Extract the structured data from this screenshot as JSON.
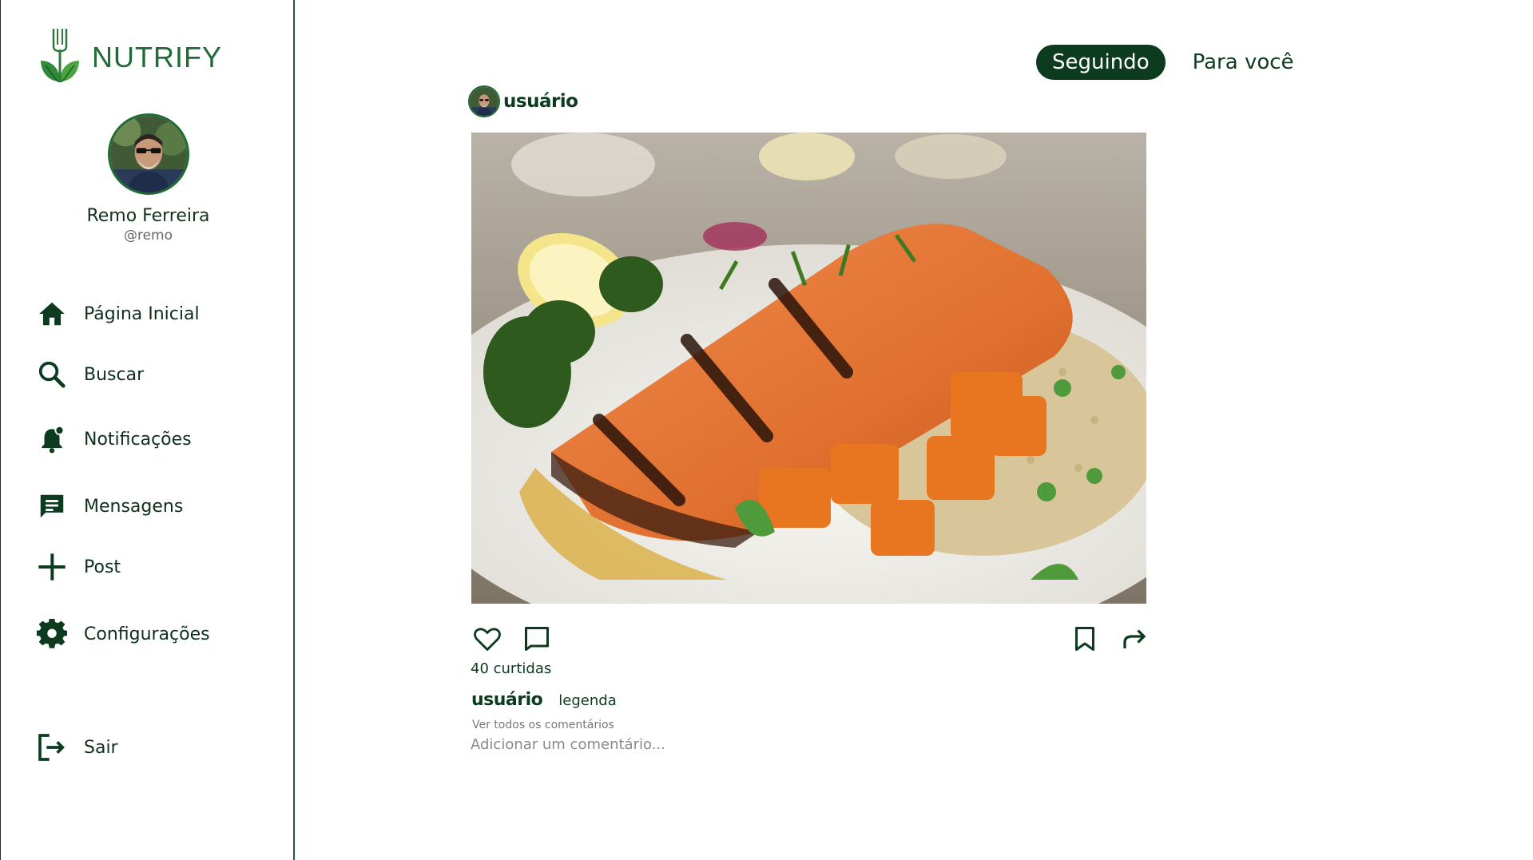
{
  "app": {
    "name": "NUTRIFY",
    "brand_color": "#1d6b35",
    "dark_color": "#0c3b1f"
  },
  "profile": {
    "name": "Remo Ferreira",
    "handle": "@remo"
  },
  "nav": {
    "home": {
      "label": "Página Inicial",
      "icon": "home-icon"
    },
    "search": {
      "label": "Buscar",
      "icon": "search-icon"
    },
    "notifications": {
      "label": "Notificações",
      "icon": "bell-icon"
    },
    "messages": {
      "label": "Mensagens",
      "icon": "message-icon"
    },
    "post": {
      "label": "Post",
      "icon": "plus-icon"
    },
    "settings": {
      "label": "Configurações",
      "icon": "gear-icon"
    },
    "logout": {
      "label": "Sair",
      "icon": "logout-icon"
    }
  },
  "feed_tabs": {
    "following": "Seguindo",
    "for_you": "Para você",
    "active": "following"
  },
  "post": {
    "username": "usuário",
    "image_subject": "grilled salmon with quinoa, carrots and broccoli",
    "likes_text": "40 curtidas",
    "caption_user": "usuário",
    "caption": "legenda",
    "view_comments": "Ver todos os comentários",
    "comment_placeholder": "Adicionar um comentário..."
  }
}
